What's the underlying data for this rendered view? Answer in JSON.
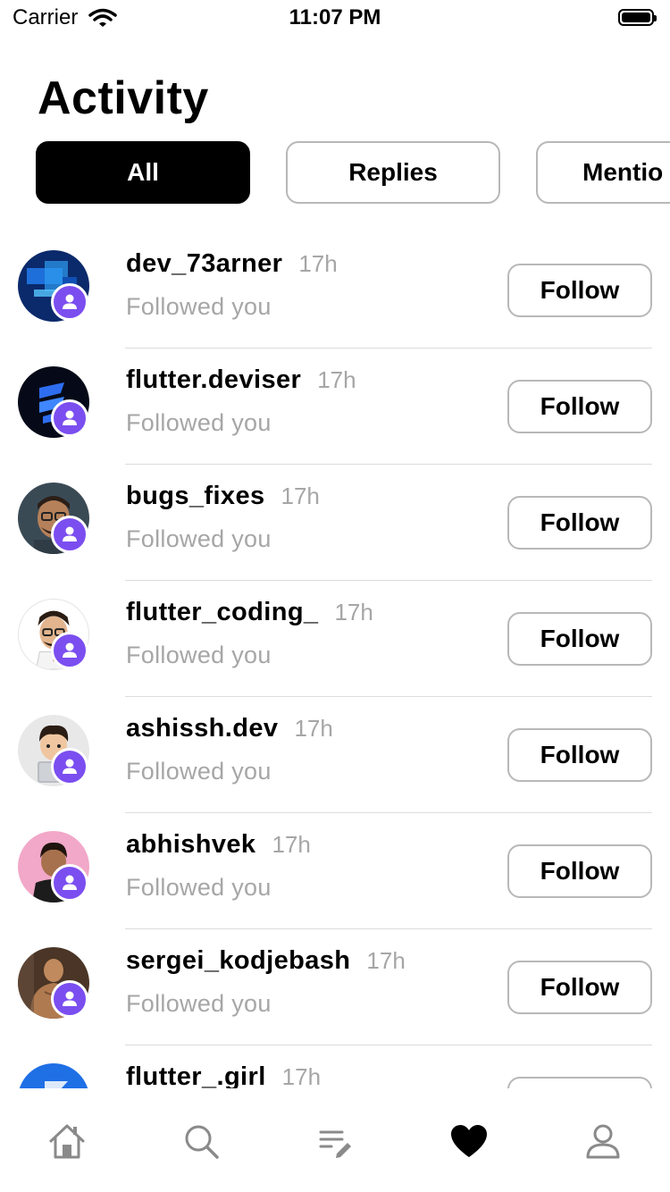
{
  "status_bar": {
    "carrier": "Carrier",
    "time": "11:07 PM"
  },
  "header": {
    "title": "Activity"
  },
  "filters": [
    {
      "label": "All",
      "active": true
    },
    {
      "label": "Replies",
      "active": false
    },
    {
      "label": "Mentio",
      "active": false
    }
  ],
  "activity": [
    {
      "username": "dev_73arner",
      "time": "17h",
      "subtext": "Followed you",
      "action": "Follow"
    },
    {
      "username": "flutter.deviser",
      "time": "17h",
      "subtext": "Followed you",
      "action": "Follow"
    },
    {
      "username": "bugs_fixes",
      "time": "17h",
      "subtext": "Followed you",
      "action": "Follow"
    },
    {
      "username": "flutter_coding_",
      "time": "17h",
      "subtext": "Followed you",
      "action": "Follow"
    },
    {
      "username": "ashissh.dev",
      "time": "17h",
      "subtext": "Followed you",
      "action": "Follow"
    },
    {
      "username": "abhishvek",
      "time": "17h",
      "subtext": "Followed you",
      "action": "Follow"
    },
    {
      "username": "sergei_kodjebash",
      "time": "17h",
      "subtext": "Followed you",
      "action": "Follow"
    },
    {
      "username": "flutter_.girl",
      "time": "17h",
      "subtext": "",
      "action": ""
    }
  ],
  "tab_bar": {
    "tabs": [
      "home-icon",
      "search-icon",
      "compose-icon",
      "heart-icon",
      "profile-icon"
    ],
    "active_tab": "heart-icon"
  },
  "colors": {
    "badge": "#7b4ef0",
    "muted_text": "#a6a6a6",
    "border": "#b8b8b8"
  }
}
